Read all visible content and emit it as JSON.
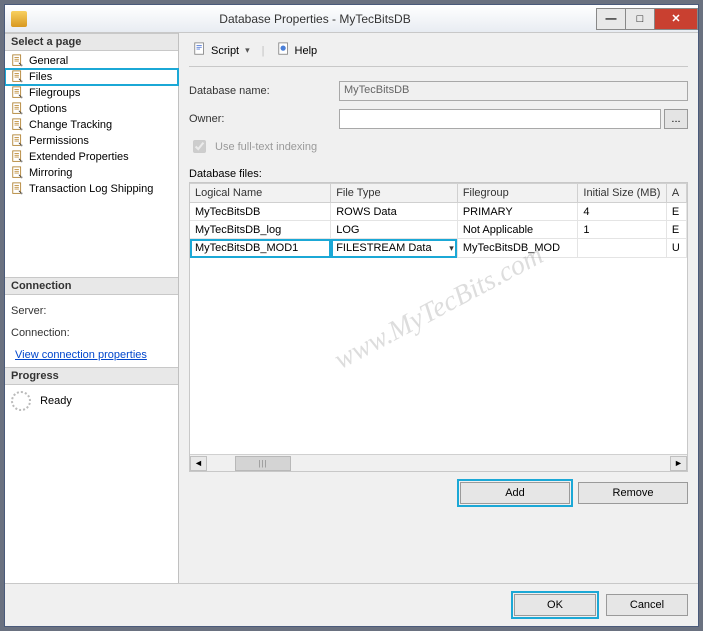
{
  "window": {
    "title": "Database Properties - MyTecBitsDB"
  },
  "left": {
    "select_page": "Select a page",
    "pages": [
      "General",
      "Files",
      "Filegroups",
      "Options",
      "Change Tracking",
      "Permissions",
      "Extended Properties",
      "Mirroring",
      "Transaction Log Shipping"
    ],
    "selected_index": 1,
    "connection_hd": "Connection",
    "server_lbl": "Server:",
    "connection_lbl": "Connection:",
    "view_conn": "View connection properties",
    "progress_hd": "Progress",
    "ready": "Ready"
  },
  "toolbar": {
    "script": "Script",
    "help": "Help"
  },
  "form": {
    "dbname_lbl": "Database name:",
    "dbname_val": "MyTecBitsDB",
    "owner_lbl": "Owner:",
    "owner_val": "",
    "browse": "...",
    "fulltext": "Use full-text indexing",
    "files_lbl": "Database files:"
  },
  "grid": {
    "cols": [
      "Logical Name",
      "File Type",
      "Filegroup",
      "Initial Size (MB)",
      "A"
    ],
    "rows": [
      {
        "name": "MyTecBitsDB",
        "type": "ROWS Data",
        "fg": "PRIMARY",
        "size": "4",
        "a": "E"
      },
      {
        "name": "MyTecBitsDB_log",
        "type": "LOG",
        "fg": "Not Applicable",
        "size": "1",
        "a": "E"
      },
      {
        "name": "MyTecBitsDB_MOD1",
        "type": "FILESTREAM Data",
        "fg": "MyTecBitsDB_MOD",
        "size": "",
        "a": "U"
      }
    ]
  },
  "buttons": {
    "add": "Add",
    "remove": "Remove",
    "ok": "OK",
    "cancel": "Cancel"
  },
  "watermark": "www.MyTecBits.com"
}
